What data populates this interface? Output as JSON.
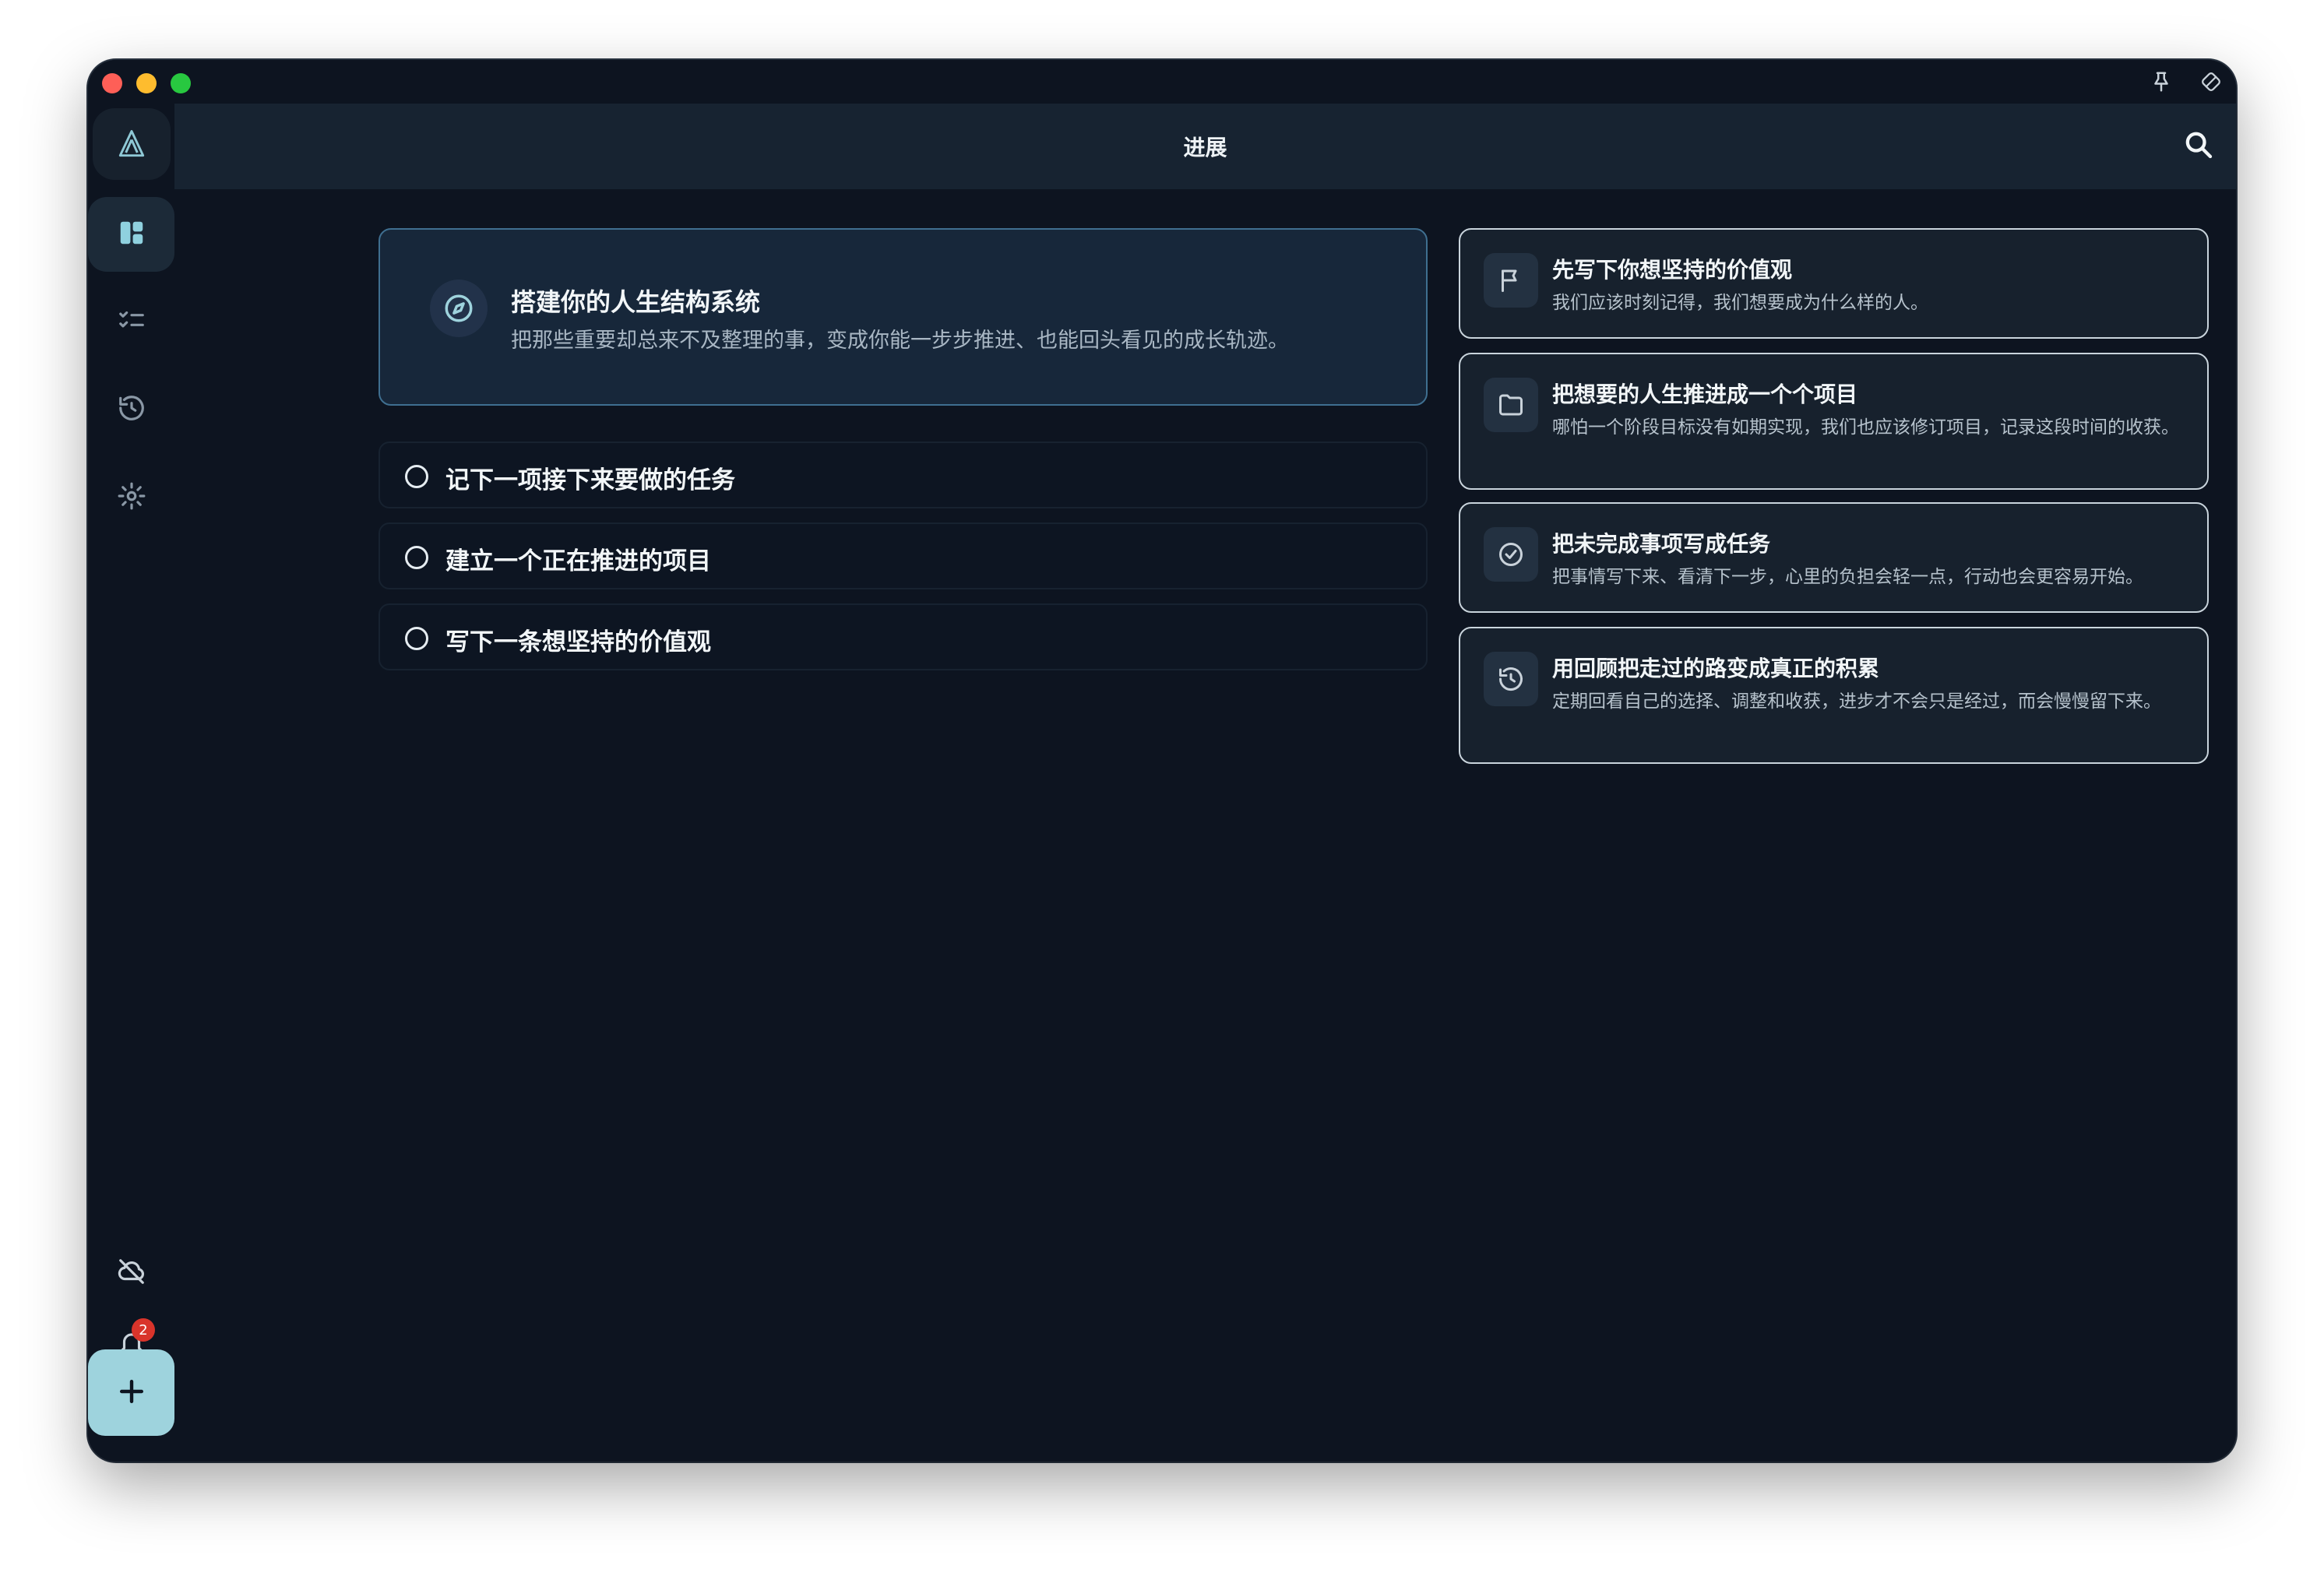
{
  "window": {
    "traffic_lights": [
      "close",
      "minimize",
      "zoom"
    ],
    "titlebar_icons": [
      "pin-icon",
      "rotate-icon"
    ]
  },
  "header": {
    "title": "进展",
    "search_icon": "search-icon"
  },
  "sidebar": {
    "logo_icon": "app-logo-icon",
    "items": [
      {
        "icon": "dashboard-icon",
        "active": true
      },
      {
        "icon": "task-list-icon",
        "active": false
      },
      {
        "icon": "history-icon",
        "active": false
      },
      {
        "icon": "settings-icon",
        "active": false
      }
    ],
    "bottom": [
      {
        "icon": "cloud-off-icon"
      },
      {
        "icon": "bell-icon",
        "badge": "2"
      }
    ],
    "add_icon": "plus-icon"
  },
  "hero": {
    "icon": "compass-icon",
    "title": "搭建你的人生结构系统",
    "subtitle": "把那些重要却总来不及整理的事，变成你能一步步推进、也能回头看见的成长轨迹。"
  },
  "tasks": [
    {
      "label": "记下一项接下来要做的任务"
    },
    {
      "label": "建立一个正在推进的项目"
    },
    {
      "label": "写下一条想坚持的价值观"
    }
  ],
  "tips": [
    {
      "icon": "flag-icon",
      "title": "先写下你想坚持的价值观",
      "desc": "我们应该时刻记得，我们想要成为什么样的人。"
    },
    {
      "icon": "folder-icon",
      "title": "把想要的人生推进成一个个项目",
      "desc": "哪怕一个阶段目标没有如期实现，我们也应该修订项目，记录这段时间的收获。"
    },
    {
      "icon": "check-circle-icon",
      "title": "把未完成事项写成任务",
      "desc": "把事情写下来、看清下一步，心里的负担会轻一点，行动也会更容易开始。"
    },
    {
      "icon": "history-icon",
      "title": "用回顾把走过的路变成真正的积累",
      "desc": "定期回看自己的选择、调整和收获，进步才不会只是经过，而会慢慢留下来。"
    }
  ],
  "colors": {
    "background": "#0d1420",
    "header": "#172331",
    "card": "#17212d",
    "hero_border": "#3f6f90",
    "accent": "#9ed3dd",
    "badge": "#d9342b"
  }
}
